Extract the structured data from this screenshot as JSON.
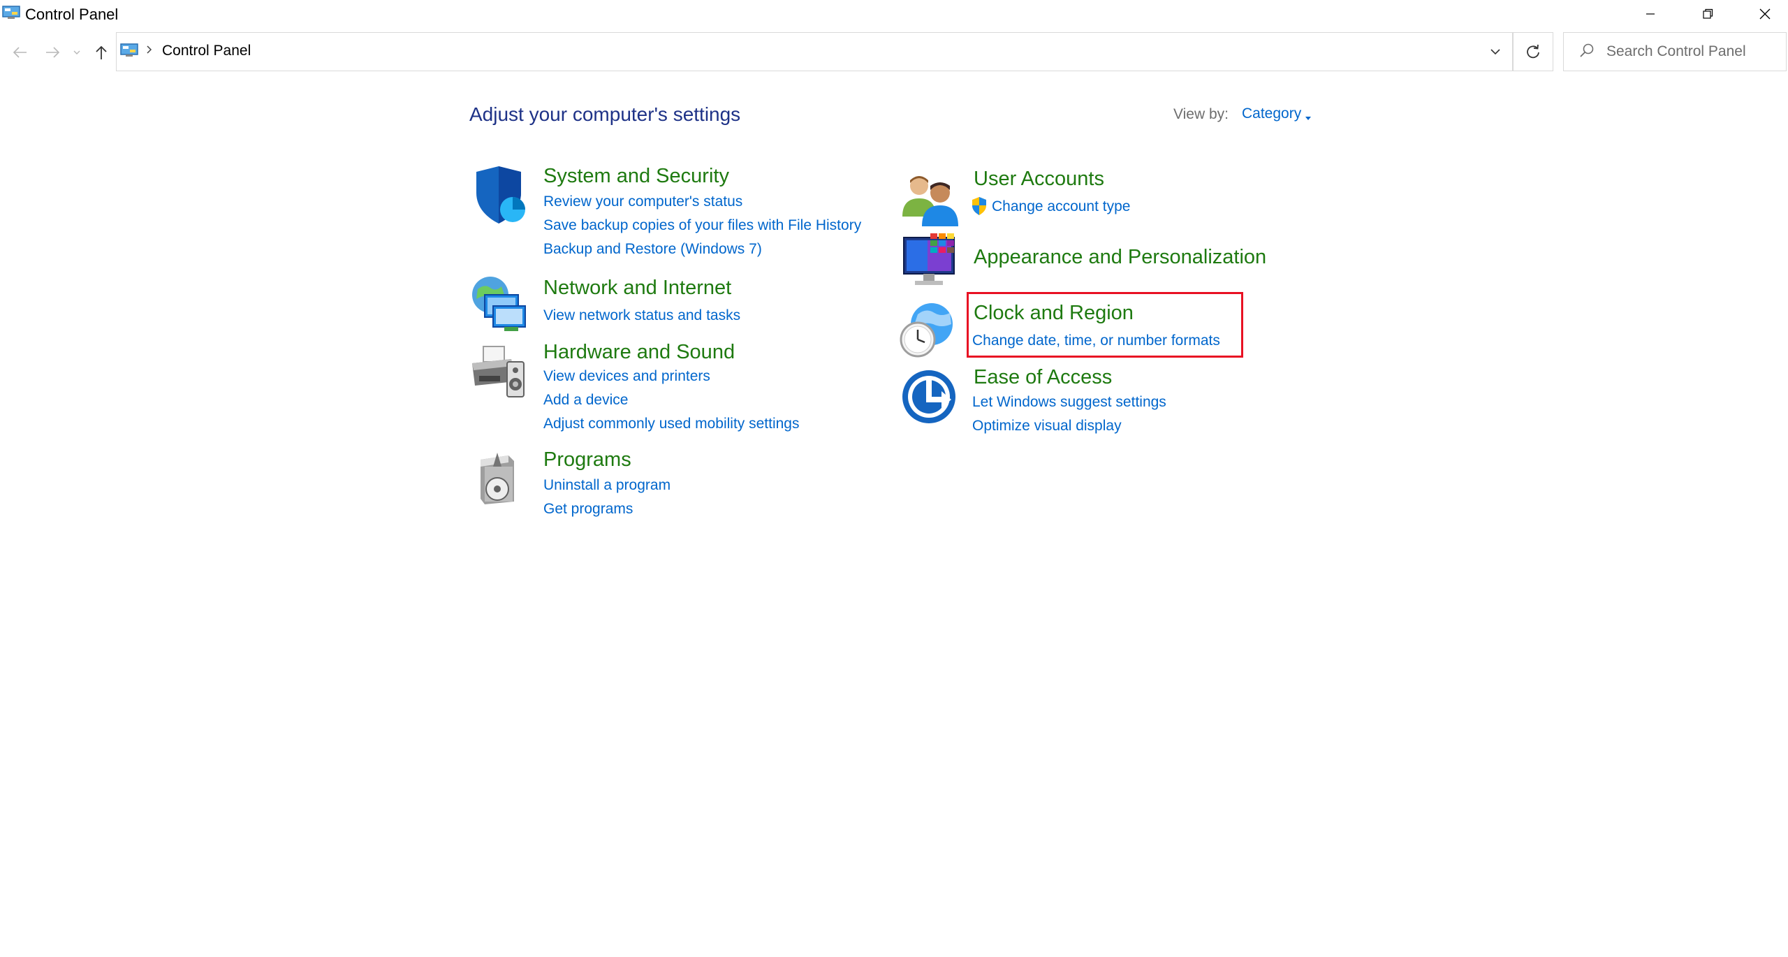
{
  "window": {
    "title": "Control Panel"
  },
  "address": {
    "path": "Control Panel"
  },
  "search": {
    "placeholder": "Search Control Panel"
  },
  "page": {
    "title": "Adjust your computer's settings",
    "view_by_label": "View by:",
    "view_by_value": "Category"
  },
  "categories": {
    "system_security": {
      "title": "System and Security",
      "links": [
        "Review your computer's status",
        "Save backup copies of your files with File History",
        "Backup and Restore (Windows 7)"
      ]
    },
    "network": {
      "title": "Network and Internet",
      "links": [
        "View network status and tasks"
      ]
    },
    "hardware": {
      "title": "Hardware and Sound",
      "links": [
        "View devices and printers",
        "Add a device",
        "Adjust commonly used mobility settings"
      ]
    },
    "programs": {
      "title": "Programs",
      "links": [
        "Uninstall a program",
        "Get programs"
      ]
    },
    "user_accounts": {
      "title": "User Accounts",
      "links": [
        "Change account type"
      ]
    },
    "appearance": {
      "title": "Appearance and Personalization"
    },
    "clock_region": {
      "title": "Clock and Region",
      "links": [
        "Change date, time, or number formats"
      ]
    },
    "ease_access": {
      "title": "Ease of Access",
      "links": [
        "Let Windows suggest settings",
        "Optimize visual display"
      ]
    }
  },
  "colors": {
    "category_title": "#1e7a10",
    "link": "#0066cc",
    "page_title": "#1e3287",
    "highlight": "#e81123"
  }
}
